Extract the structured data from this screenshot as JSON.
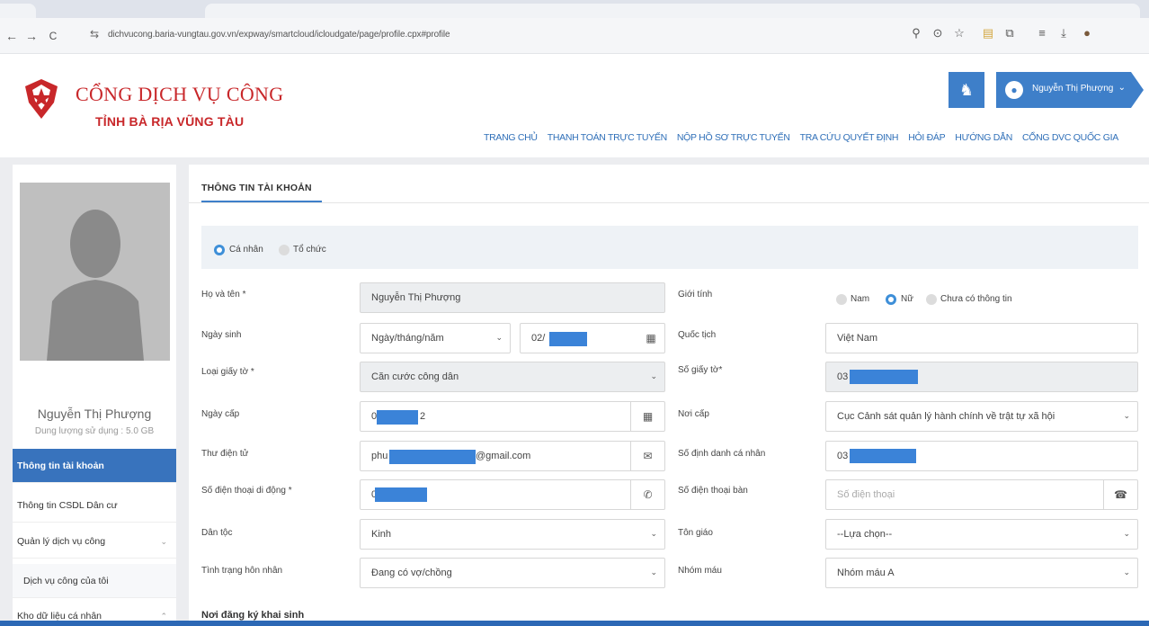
{
  "browser": {
    "url": "dichvucong.baria-vungtau.gov.vn/expway/smartcloud/icloudgate/page/profile.cpx#profile",
    "nav_icons": [
      "back-icon",
      "forward-icon",
      "reload-icon",
      "site-settings-icon"
    ],
    "nav_glyphs": [
      "←",
      "→",
      "C",
      "⇆"
    ],
    "right_icons": [
      "zoom-icon",
      "location-icon",
      "bookmark-star-icon",
      "extension-icon",
      "extensions-puzzle-icon",
      "reading-list-icon",
      "download-icon",
      "profile-avatar-icon"
    ],
    "right_glyphs": [
      "⚲",
      "⚲",
      "☆",
      "▤",
      "⧉",
      "≡",
      "⤓",
      "●"
    ]
  },
  "header": {
    "title": "CỔNG DỊCH VỤ CÔNG",
    "subtitle": "TỈNH BÀ RỊA VŨNG TÀU",
    "user_name": "Nguyễn Thị Phượng",
    "nav": [
      "TRANG CHỦ",
      "THANH TOÁN TRỰC TUYẾN",
      "NỘP HỒ SƠ TRỰC TUYẾN",
      "TRA CỨU QUYẾT ĐỊNH",
      "HỎI ĐÁP",
      "HƯỚNG DẪN",
      "CỔNG DVC QUỐC GIA"
    ],
    "colors": {
      "brand_red": "#c8272a",
      "accent_blue": "#3e7fc9"
    }
  },
  "sidebar": {
    "name": "Nguyễn Thị Phượng",
    "quota": "Dung lượng sử dụng : 5.0 GB",
    "items": [
      {
        "label": "Thông tin tài khoản",
        "active": true
      },
      {
        "label": "Thông tin CSDL Dân cư"
      },
      {
        "label": "Quản lý dịch vụ công",
        "caret": "⌄"
      },
      {
        "label": "Dịch vụ công của tôi"
      },
      {
        "label": "Kho dữ liệu cá nhân",
        "caret": "⌃"
      }
    ]
  },
  "main": {
    "tab_title": "THÔNG TIN TÀI KHOẢN",
    "account_type": {
      "options": [
        "Cá nhân",
        "Tổ chức"
      ],
      "selected": "Cá nhân"
    },
    "fields": {
      "full_name": {
        "label": "Họ và tên *",
        "value": "Nguyễn Thị Phượng"
      },
      "dob": {
        "label": "Ngày sinh",
        "format": "Ngày/tháng/năm",
        "value": "02/"
      },
      "id_type": {
        "label": "Loại giấy tờ *",
        "value": "Căn cước công dân"
      },
      "issue_date": {
        "label": "Ngày cấp",
        "value": "0",
        "value_suffix": "2"
      },
      "email": {
        "label": "Thư điện tử",
        "value": "phu",
        "value_suffix": "@gmail.com"
      },
      "mobile": {
        "label": "Số điện thoại di động *",
        "value": "0"
      },
      "ethnicity": {
        "label": "Dân tộc",
        "value": "Kinh"
      },
      "marital": {
        "label": "Tình trạng hôn nhân",
        "value": "Đang có vợ/chồng"
      },
      "gender": {
        "label": "Giới tính",
        "options": [
          "Nam",
          "Nữ",
          "Chưa có thông tin"
        ],
        "selected": "Nữ"
      },
      "nationality": {
        "label": "Quốc tịch",
        "value": "Việt Nam"
      },
      "id_number": {
        "label": "Số giấy tờ*",
        "value": "03"
      },
      "issue_place": {
        "label": "Nơi cấp",
        "value": "Cục Cảnh sát quản lý hành chính về trật tự xã hội"
      },
      "personal_id": {
        "label": "Số định danh cá nhân",
        "value": "03"
      },
      "landline": {
        "label": "Số điện thoại bàn",
        "placeholder": "Số điện thoại"
      },
      "religion": {
        "label": "Tôn giáo",
        "value": "--Lựa chọn--"
      },
      "blood_type": {
        "label": "Nhóm máu",
        "value": "Nhóm máu A"
      }
    },
    "section_birth": "Nơi đăng ký khai sinh"
  }
}
